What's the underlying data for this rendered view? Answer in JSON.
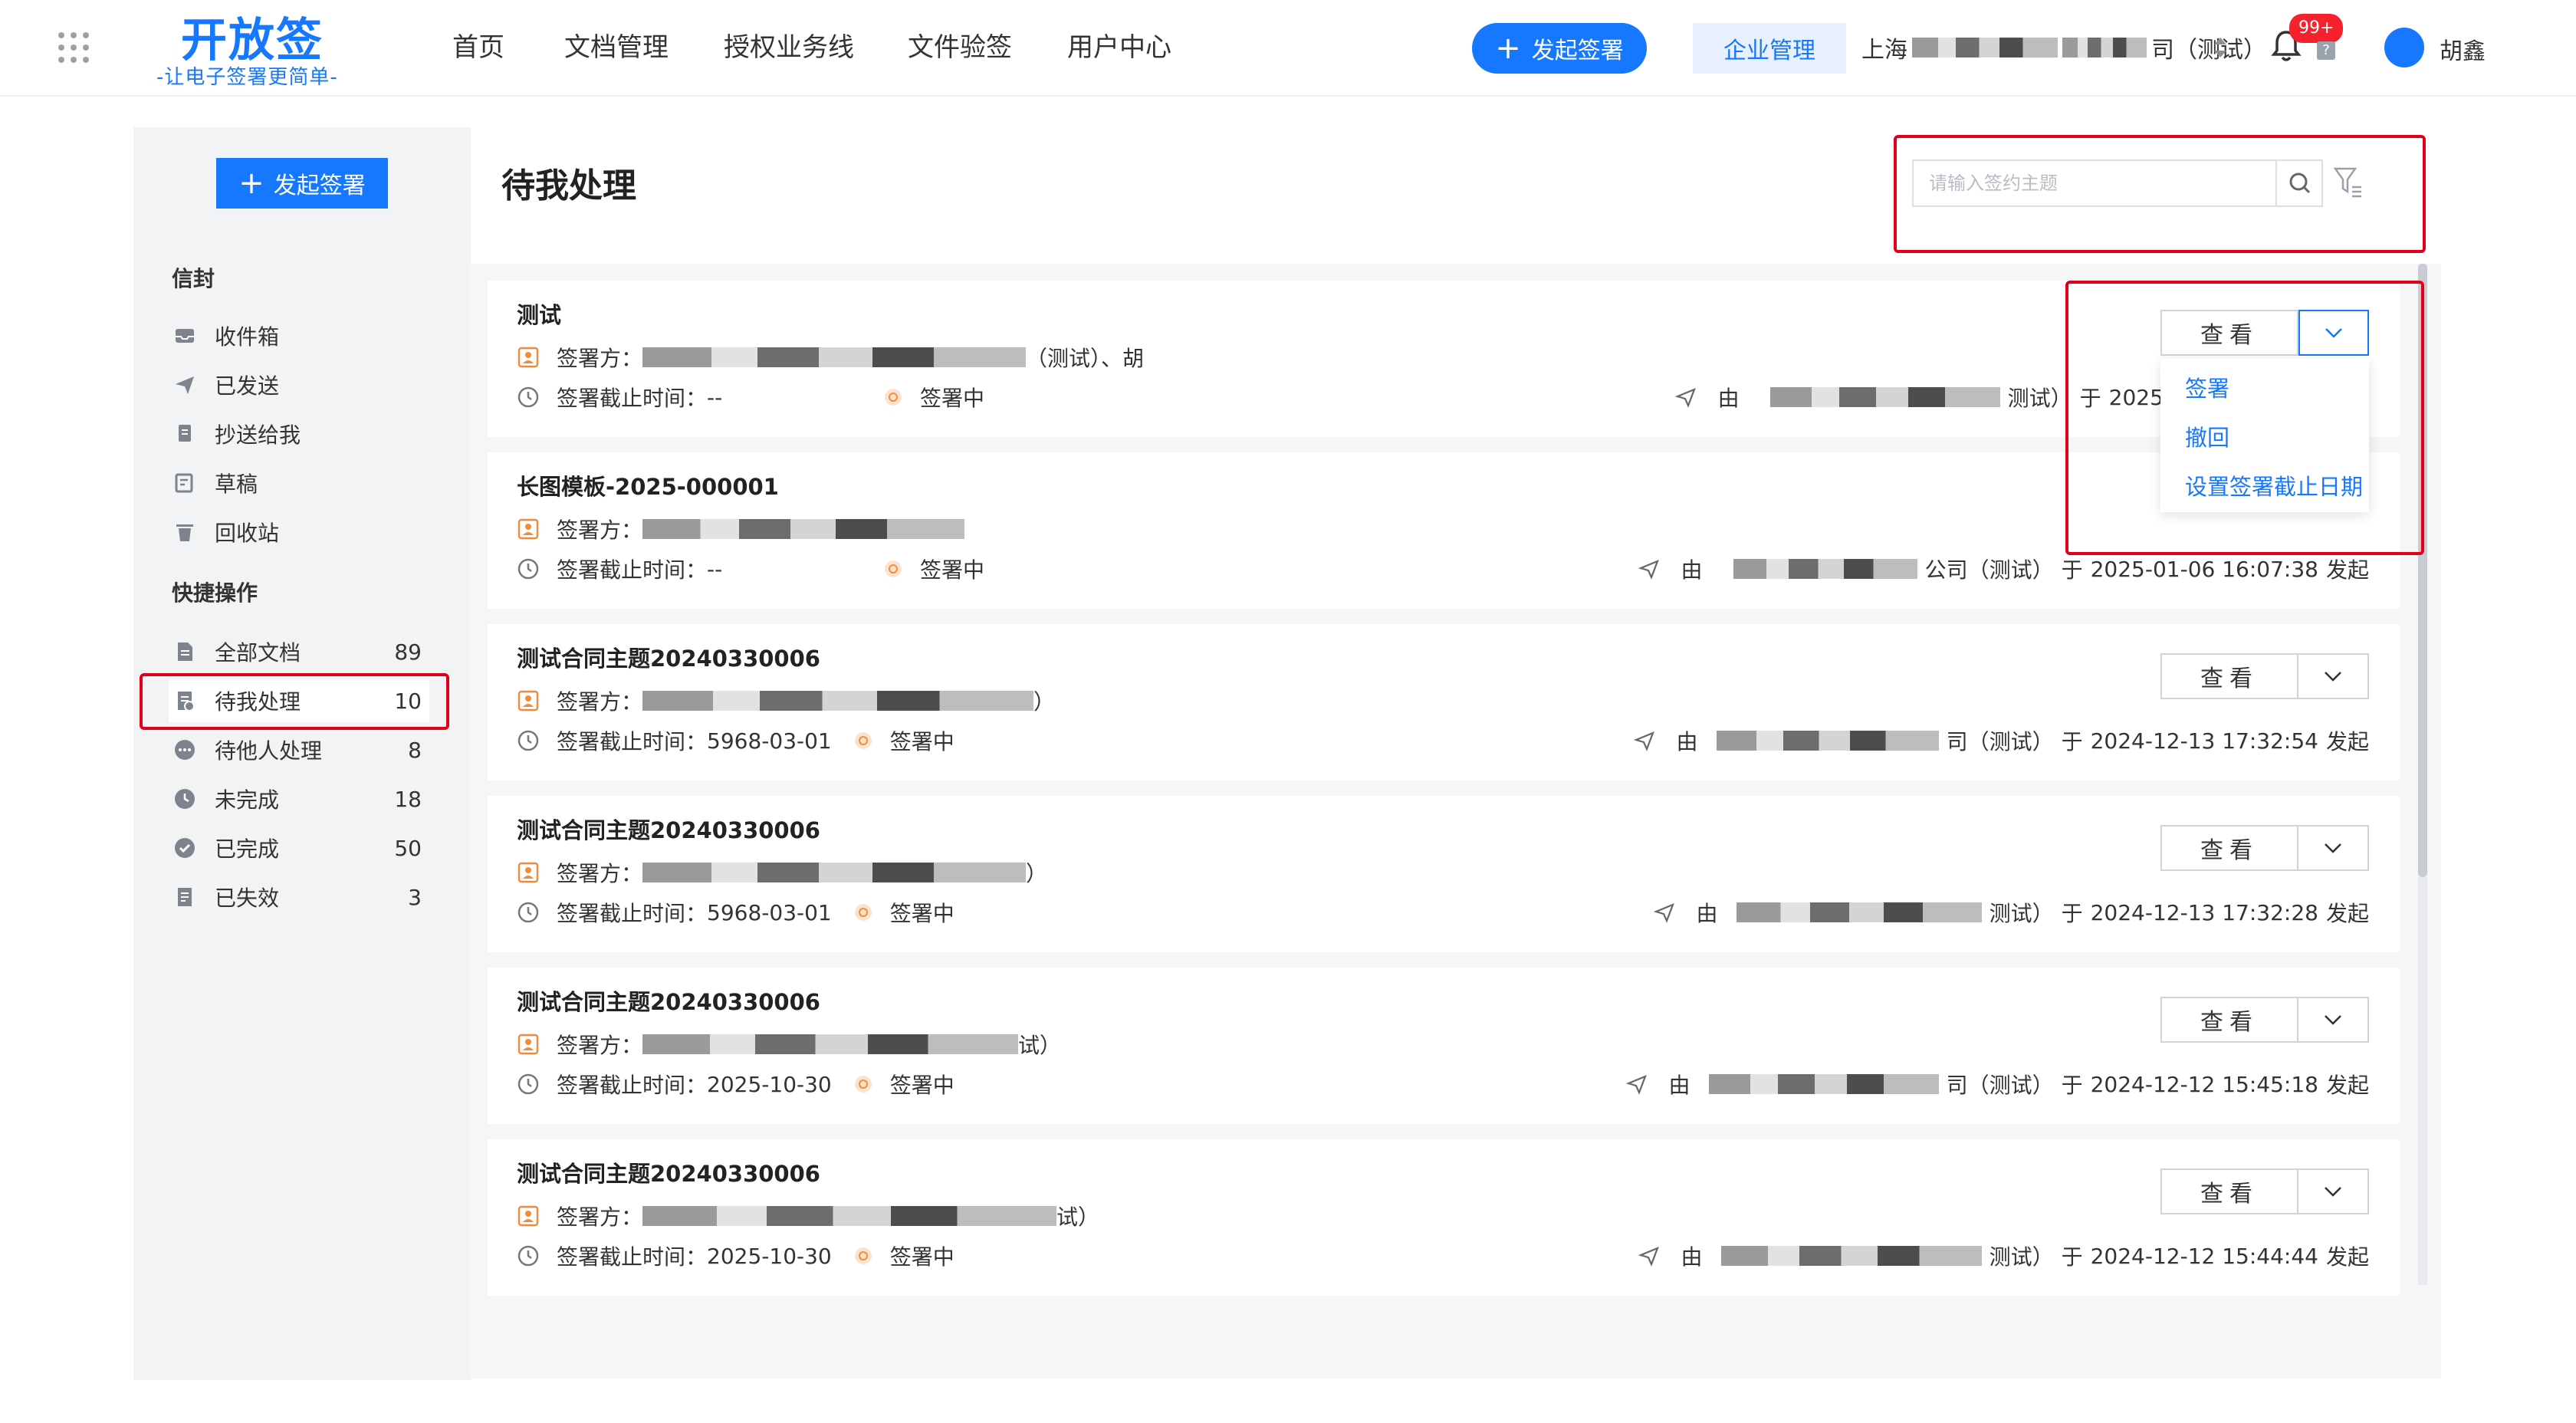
{
  "app": {
    "logo_title": "开放签",
    "logo_subtitle": "-让电子签署更简单-"
  },
  "topnav": {
    "items": [
      "首页",
      "文档管理",
      "授权业务线",
      "文件验签",
      "用户中心"
    ],
    "start_sign_label": "发起签署",
    "enterprise_label": "企业管理",
    "company_prefix": "上海",
    "company_suffix": "司（测试）",
    "notification_badge": "99+",
    "help_label": "?",
    "username": "胡鑫"
  },
  "sidebar": {
    "start_sign_label": "发起签署",
    "group_envelope": "信封",
    "envelope_items": [
      {
        "label": "收件箱",
        "icon": "inbox-icon"
      },
      {
        "label": "已发送",
        "icon": "send-icon"
      },
      {
        "label": "抄送给我",
        "icon": "cc-icon"
      },
      {
        "label": "草稿",
        "icon": "draft-icon"
      },
      {
        "label": "回收站",
        "icon": "trash-icon"
      }
    ],
    "group_quick": "快捷操作",
    "quick_items": [
      {
        "label": "全部文档",
        "count": "89",
        "icon": "document-icon"
      },
      {
        "label": "待我处理",
        "count": "10",
        "icon": "pending-me-icon"
      },
      {
        "label": "待他人处理",
        "count": "8",
        "icon": "pending-others-icon"
      },
      {
        "label": "未完成",
        "count": "18",
        "icon": "clock-icon"
      },
      {
        "label": "已完成",
        "count": "50",
        "icon": "check-circle-icon"
      },
      {
        "label": "已失效",
        "count": "3",
        "icon": "expired-icon"
      }
    ]
  },
  "main": {
    "title": "待我处理",
    "search_placeholder": "请输入签约主题",
    "labels": {
      "signer": "签署方：",
      "deadline": "签署截止时间：",
      "status": "签署中",
      "by": "由",
      "at": "于",
      "initiated": "发起",
      "view": "查看"
    },
    "cards": [
      {
        "title": "测试",
        "signer_tail": "（测试）、胡",
        "deadline": "--",
        "sender_tail": "测试）",
        "time": "2025-"
      },
      {
        "title": "长图模板-2025-000001",
        "signer_tail": "",
        "deadline": "--",
        "sender_tail": "公司（测试）",
        "time": "2025-01-06 16:07:38"
      },
      {
        "title": "测试合同主题20240330006",
        "signer_tail": "）",
        "deadline": "5968-03-01",
        "sender_tail": "司（测试）",
        "time": "2024-12-13 17:32:54"
      },
      {
        "title": "测试合同主题20240330006",
        "signer_tail": "）",
        "deadline": "5968-03-01",
        "sender_tail": "测试）",
        "time": "2024-12-13 17:32:28"
      },
      {
        "title": "测试合同主题20240330006",
        "signer_tail": "试）",
        "deadline": "2025-10-30",
        "sender_tail": "司（测试）",
        "time": "2024-12-12 15:45:18"
      },
      {
        "title": "测试合同主题20240330006",
        "signer_tail": "试）",
        "deadline": "2025-10-30",
        "sender_tail": "测试）",
        "time": "2024-12-12 15:44:44"
      }
    ],
    "dropdown_items": [
      "签署",
      "撤回",
      "设置签署截止日期"
    ]
  },
  "colors": {
    "accent": "#1677ff",
    "annotation": "#e0001b",
    "badge": "#f5222d"
  }
}
